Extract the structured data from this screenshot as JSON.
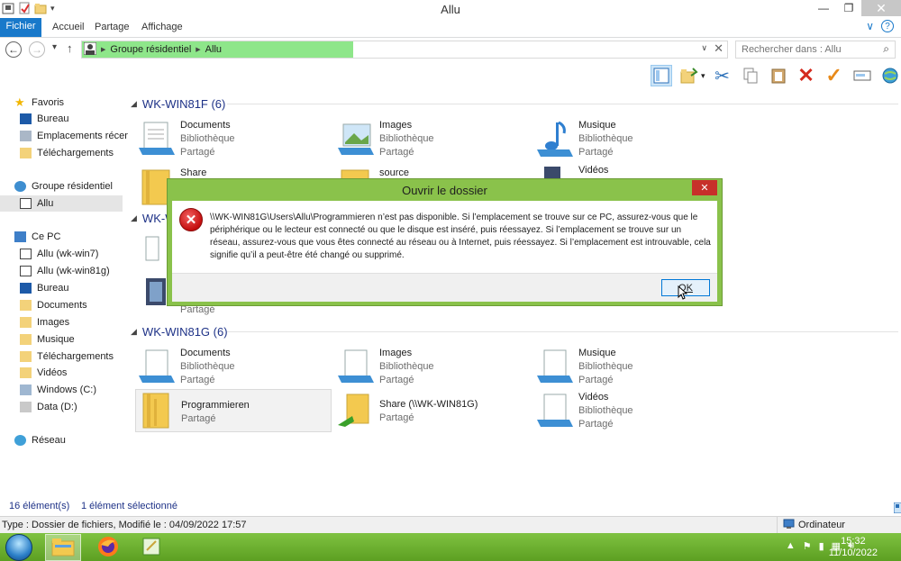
{
  "window": {
    "title": "Allu",
    "minimize": "—",
    "maximize": "❐",
    "close": "✕"
  },
  "ribbon": {
    "tabs": [
      "Fichier",
      "Accueil",
      "Partage",
      "Affichage"
    ],
    "expand": "∨",
    "help": "?"
  },
  "address": {
    "segments": [
      "Groupe résidentiel",
      "Allu"
    ],
    "progress_fraction": 0.42,
    "search_placeholder": "Rechercher dans : Allu"
  },
  "sidebar": {
    "favorites": {
      "label": "Favoris",
      "items": [
        "Bureau",
        "Emplacements récen",
        "Téléchargements"
      ]
    },
    "homegroup": {
      "label": "Groupe résidentiel",
      "items": [
        "Allu"
      ]
    },
    "pc": {
      "label": "Ce PC",
      "items": [
        "Allu (wk-win7)",
        "Allu (wk-win81g)",
        "Bureau",
        "Documents",
        "Images",
        "Musique",
        "Téléchargements",
        "Vidéos",
        "Windows (C:)",
        "Data (D:)"
      ]
    },
    "network": {
      "label": "Réseau"
    }
  },
  "groups": [
    {
      "header": "WK-WIN81F (6)",
      "items": [
        {
          "name": "Documents",
          "sub1": "Bibliothèque",
          "sub2": "Partagé"
        },
        {
          "name": "Images",
          "sub1": "Bibliothèque",
          "sub2": "Partagé"
        },
        {
          "name": "Musique",
          "sub1": "Bibliothèque",
          "sub2": "Partagé"
        },
        {
          "name": "Share",
          "sub1": "",
          "sub2": ""
        },
        {
          "name": "source",
          "sub1": "",
          "sub2": ""
        },
        {
          "name": "Vidéos",
          "sub1": "",
          "sub2": ""
        }
      ]
    },
    {
      "header": "WK-W",
      "items": [
        {
          "name": "",
          "sub1": "",
          "sub2": "Partagé"
        }
      ]
    },
    {
      "header": "WK-WIN81G (6)",
      "items": [
        {
          "name": "Documents",
          "sub1": "Bibliothèque",
          "sub2": "Partagé"
        },
        {
          "name": "Images",
          "sub1": "Bibliothèque",
          "sub2": "Partagé"
        },
        {
          "name": "Musique",
          "sub1": "Bibliothèque",
          "sub2": "Partagé"
        },
        {
          "name": "Programmieren",
          "sub1": "Partagé",
          "sub2": ""
        },
        {
          "name": "Share (\\\\WK-WIN81G)",
          "sub1": "Partagé",
          "sub2": ""
        },
        {
          "name": "Vidéos",
          "sub1": "Bibliothèque",
          "sub2": "Partagé"
        }
      ]
    }
  ],
  "status": {
    "count": "16 élément(s)",
    "selected": "1 élément sélectionné"
  },
  "details": {
    "type": "Type : Dossier de fichiers, Modifié le : 04/09/2022 17:57",
    "computer": "Ordinateur"
  },
  "taskbar": {
    "time": "15:32",
    "date": "11/10/2022"
  },
  "dialog": {
    "title": "Ouvrir le dossier",
    "close": "✕",
    "message": "\\\\WK-WIN81G\\Users\\Allu\\Programmieren n’est pas disponible. Si l’emplacement se trouve sur ce PC, assurez-vous que le périphérique ou le lecteur est connecté ou que le disque est inséré, puis réessayez. Si l’emplacement se trouve sur un réseau, assurez-vous que vous êtes connecté au réseau ou à Internet, puis réessayez. Si l’emplacement est introuvable, cela signifie qu’il a peut-être été changé ou supprimé.",
    "ok": "OK"
  },
  "colors": {
    "accent": "#1979ca",
    "dialog_frame": "#8ac24b",
    "taskbar": "#6aaf2c",
    "progress": "#8ee68a",
    "error": "#c40e0e"
  }
}
